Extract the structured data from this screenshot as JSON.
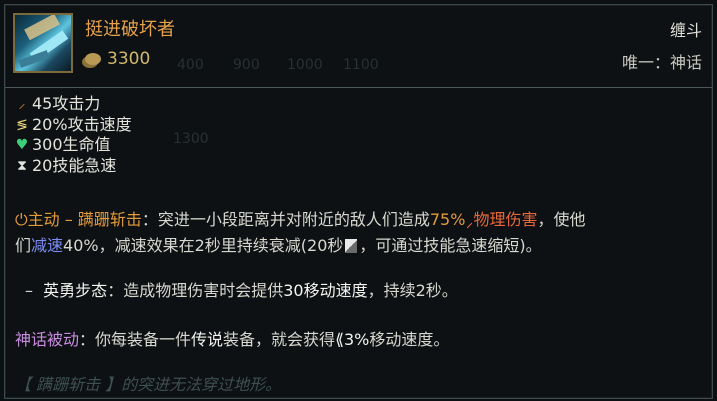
{
  "item": {
    "name": "挺进破坏者",
    "cost": "3300",
    "category": "缠斗",
    "limit": "唯一：神话"
  },
  "stats": [
    {
      "icon": "attack-damage-icon",
      "text": "45攻击力"
    },
    {
      "icon": "attack-speed-icon",
      "text": "20%攻击速度"
    },
    {
      "icon": "health-icon",
      "text": "300生命值"
    },
    {
      "icon": "ability-haste-icon",
      "text": "20技能急速"
    }
  ],
  "active": {
    "title": "主动 – 蹒跚斩击",
    "colon": "：",
    "text1": "突进一小段距离并对附近的敌人们造成",
    "percent": "75%",
    "damage": "物理伤害",
    "text2": "，使他",
    "line2_pre": "们",
    "slow": "减速",
    "line2_text": "40%，减速效果在2秒里持续衰减(20秒",
    "line2_end": "，可通过技能急速缩短)。"
  },
  "valor": {
    "dash": "–",
    "name": "英勇步态",
    "text1": "：造成物理伤害时会提供",
    "bold": "30移动速度",
    "text2": "，持续2秒。"
  },
  "mythic": {
    "title": "神话被动",
    "text1": "：你每装备一件",
    "legend": "传说",
    "text2": "装备，就会获得",
    "amount": "3%",
    "text3": "移动速度。"
  },
  "lore": "【 蹒跚斩击 】的突进无法穿过地形。",
  "ghost_shop_prices": [
    "400",
    "900",
    "1000",
    "1100",
    "1300"
  ]
}
